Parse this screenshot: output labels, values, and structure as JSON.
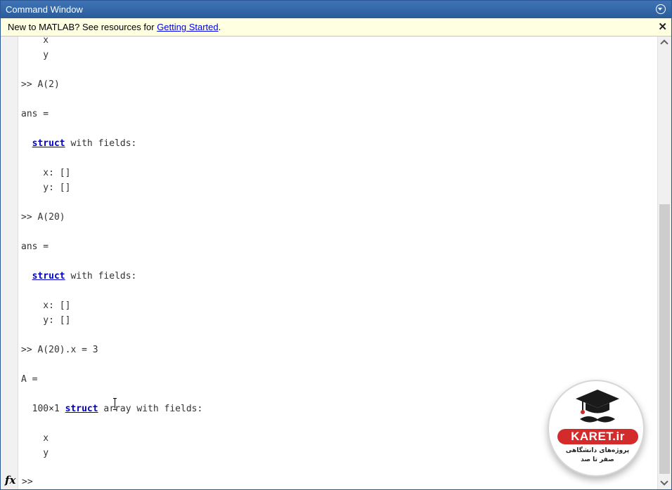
{
  "window": {
    "title": "Command Window"
  },
  "infobar": {
    "text": "New to MATLAB? See resources for ",
    "link": "Getting Started",
    "suffix": ".",
    "close_glyph": "✕"
  },
  "console_lines": [
    {
      "text": "    x"
    },
    {
      "text": "    y"
    },
    {
      "text": ""
    },
    {
      "text": ">> A(2)"
    },
    {
      "text": ""
    },
    {
      "text": "ans ="
    },
    {
      "text": ""
    },
    {
      "pre": "  ",
      "kw": "struct",
      "post": " with fields:"
    },
    {
      "text": ""
    },
    {
      "text": "    x: []"
    },
    {
      "text": "    y: []"
    },
    {
      "text": ""
    },
    {
      "text": ">> A(20)"
    },
    {
      "text": ""
    },
    {
      "text": "ans ="
    },
    {
      "text": ""
    },
    {
      "pre": "  ",
      "kw": "struct",
      "post": " with fields:"
    },
    {
      "text": ""
    },
    {
      "text": "    x: []"
    },
    {
      "text": "    y: []"
    },
    {
      "text": ""
    },
    {
      "text": ">> A(20).x = 3"
    },
    {
      "text": ""
    },
    {
      "text": "A ="
    },
    {
      "text": ""
    },
    {
      "pre": "  100×1 ",
      "kw": "struct",
      "post": " array with fields:"
    },
    {
      "text": ""
    },
    {
      "text": "    x"
    },
    {
      "text": "    y"
    }
  ],
  "prompt": {
    "fx_label": "fx",
    "prompt_text": ">>"
  },
  "watermark": {
    "brand": "KARET.ir",
    "subtitle_line1": "پروژه‌های دانشگاهی",
    "subtitle_line2": "صفر تا صد"
  },
  "colors": {
    "title_bar": "#2b5c9c",
    "infobar_bg": "#ffffe1",
    "keyword": "#0000cc",
    "brand": "#d32b2b"
  },
  "icons": {
    "title_menu": "circle-chevron-down-icon",
    "scroll_up": "chevron-up-icon",
    "scroll_down": "chevron-down-icon",
    "logo": "graduation-cap-mustache-icon"
  }
}
